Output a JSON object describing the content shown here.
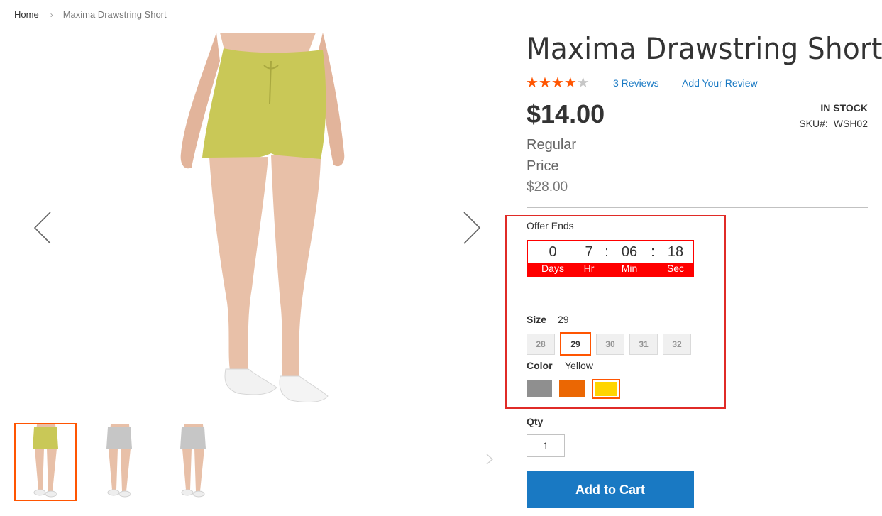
{
  "breadcrumb": {
    "home": "Home",
    "separator": "›",
    "current": "Maxima Drawstring Short"
  },
  "gallery": {
    "prev_icon": "chevron-left-icon",
    "next_icon": "chevron-right-icon",
    "thumbnails": [
      {
        "color": "#c9c857",
        "active": true
      },
      {
        "color": "#c6c6c6",
        "active": false
      },
      {
        "color": "#c6c6c6",
        "active": false
      }
    ]
  },
  "product": {
    "title": "Maxima Drawstring Short",
    "rating": {
      "filled": 4,
      "total": 5
    },
    "reviews_link": "3 Reviews",
    "add_review_link": "Add Your Review",
    "price": "$14.00",
    "regular_price_label": "Regular Price",
    "regular_price_value": "$28.00",
    "stock": "IN STOCK",
    "sku_label": "SKU#:",
    "sku_value": "WSH02"
  },
  "offer": {
    "label": "Offer Ends",
    "days": "0",
    "hours": "7",
    "minutes": "06",
    "seconds": "18",
    "sep": ":",
    "days_label": "Days",
    "hours_label": "Hr",
    "minutes_label": "Min",
    "seconds_label": "Sec",
    "accent_color": "#ff0000"
  },
  "size": {
    "label": "Size",
    "selected": "29",
    "options": [
      "28",
      "29",
      "30",
      "31",
      "32"
    ]
  },
  "color": {
    "label": "Color",
    "selected": "Yellow",
    "swatches": [
      {
        "name": "Gray",
        "hex": "#8f8f8f"
      },
      {
        "name": "Orange",
        "hex": "#eb6703"
      },
      {
        "name": "Yellow",
        "hex": "#ffd500"
      }
    ]
  },
  "qty": {
    "label": "Qty",
    "value": "1"
  },
  "cart": {
    "button_label": "Add to Cart"
  },
  "colors": {
    "link": "#1979c3",
    "accent": "#ff5501",
    "button": "#1979c3",
    "highlight_border": "#e02b27"
  }
}
